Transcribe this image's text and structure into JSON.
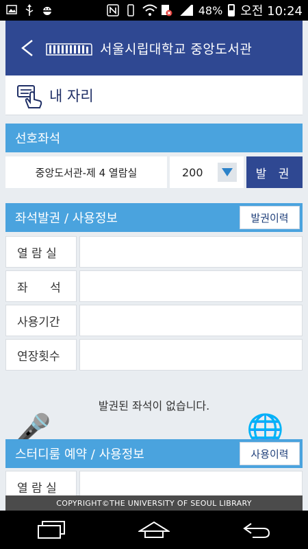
{
  "status_bar": {
    "battery_percent": "48%",
    "clock": "오전 10:24"
  },
  "header": {
    "title": "서울시립대학교 중앙도서관"
  },
  "my_seat": {
    "label": "내 자리"
  },
  "preferred": {
    "section_title": "선호좌석",
    "room": "중앙도서관-제 4 열람실",
    "seat_number": "200",
    "issue_label": "발 권"
  },
  "seat_info": {
    "section_title": "좌석발권 / 사용정보",
    "history_label": "발권이력",
    "rows": [
      {
        "label": "열 람 실",
        "value": ""
      },
      {
        "label": "좌      석",
        "value": ""
      },
      {
        "label": "사용기간",
        "value": ""
      },
      {
        "label": "연장횟수",
        "value": ""
      }
    ],
    "empty_message": "발권된 좌석이 없습니다."
  },
  "study_room": {
    "section_title": "스터디룸 예약 / 사용정보",
    "history_label": "사용이력",
    "first_row_label": "열 람 실"
  },
  "footer": {
    "copyright": "COPYRIGHT©THE UNIVERSITY OF SEOUL LIBRARY"
  },
  "colors": {
    "header_bg": "#2f4892",
    "section_bg": "#4aa3de",
    "footer_bg": "#4b4b4b"
  }
}
